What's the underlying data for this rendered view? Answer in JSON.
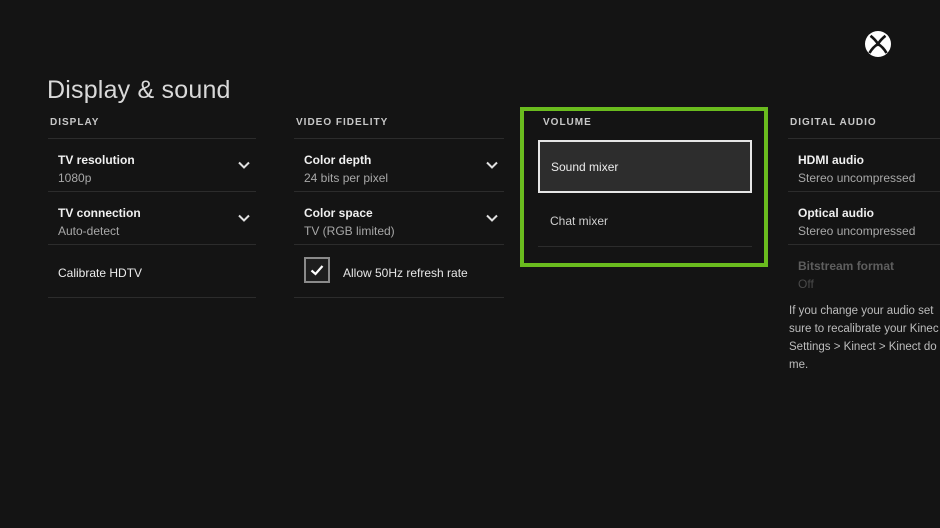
{
  "page_title": "Display & sound",
  "colors": {
    "accent_focus": "#6abb1e",
    "background": "#141414"
  },
  "logo_icon": "xbox-logo-icon",
  "display": {
    "header": "DISPLAY",
    "items": [
      {
        "label": "TV resolution",
        "value": "1080p",
        "icon": "chevron-down-icon"
      },
      {
        "label": "TV connection",
        "value": "Auto-detect",
        "icon": "chevron-down-icon"
      },
      {
        "label": "Calibrate HDTV"
      }
    ]
  },
  "video_fidelity": {
    "header": "VIDEO FIDELITY",
    "items": [
      {
        "label": "Color depth",
        "value": "24 bits per pixel",
        "icon": "chevron-down-icon"
      },
      {
        "label": "Color space",
        "value": "TV (RGB limited)",
        "icon": "chevron-down-icon"
      }
    ],
    "checkbox": {
      "label": "Allow 50Hz refresh rate",
      "checked": true
    }
  },
  "volume": {
    "header": "VOLUME",
    "items": [
      {
        "label": "Sound mixer",
        "selected": true
      },
      {
        "label": "Chat mixer",
        "selected": false
      }
    ]
  },
  "digital_audio": {
    "header": "DIGITAL AUDIO",
    "items": [
      {
        "label": "HDMI audio",
        "value": "Stereo uncompressed"
      },
      {
        "label": "Optical audio",
        "value": "Stereo uncompressed"
      },
      {
        "label": "Bitstream format",
        "value": "Off",
        "disabled": true
      }
    ],
    "note_lines": [
      "If you change your audio set",
      "sure to recalibrate your Kinec",
      "Settings > Kinect > Kinect do",
      "me."
    ]
  }
}
